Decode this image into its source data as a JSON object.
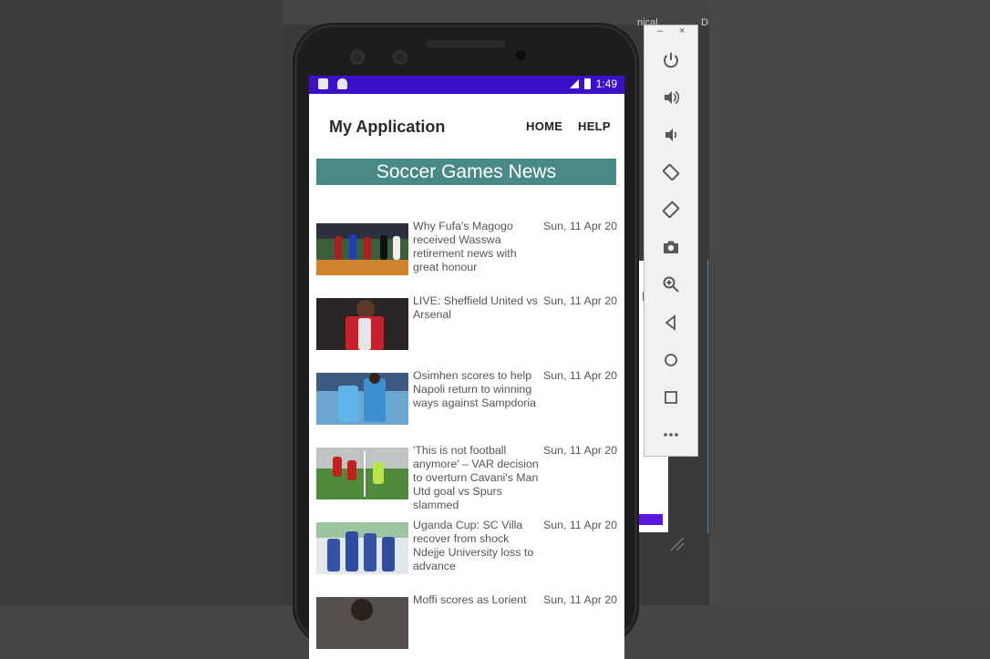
{
  "background": {
    "window_text_1": "nical",
    "window_text_2": "D"
  },
  "statusbar": {
    "time": "1:49",
    "signal": "LTE"
  },
  "appbar": {
    "title": "My Application",
    "nav": [
      "HOME",
      "HELP"
    ]
  },
  "banner": {
    "title": "Soccer Games News"
  },
  "news": [
    {
      "headline": "Why Fufa's Magogo received Wasswa retirement news with great honour",
      "date": "Sun, 11 Apr 20",
      "thumb": "players-on-pitch"
    },
    {
      "headline": "LIVE: Sheffield United vs Arsenal",
      "date": "Sun, 11 Apr 20",
      "thumb": "arsenal-player"
    },
    {
      "headline": "Osimhen scores to help Napoli return to winning ways against Sampdoria",
      "date": "Sun, 11 Apr 20",
      "thumb": "napoli-celebration"
    },
    {
      "headline": "'This is not football anymore' – VAR decision to overturn Cavani's Man Utd goal vs Spurs slammed",
      "date": "Sun, 11 Apr 20",
      "thumb": "goalmouth-action"
    },
    {
      "headline": "Uganda Cup: SC Villa recover from shock Ndejje University loss to advance",
      "date": "Sun, 11 Apr 20",
      "thumb": "team-celebration"
    },
    {
      "headline": "Moffi scores as Lorient",
      "date": "Sun, 11 Apr 20",
      "thumb": "player-portrait"
    }
  ],
  "toolbar": {
    "minimize": "–",
    "close": "×",
    "buttons": [
      {
        "icon": "power-icon"
      },
      {
        "icon": "volume-up-icon"
      },
      {
        "icon": "volume-down-icon"
      },
      {
        "icon": "rotate-left-icon"
      },
      {
        "icon": "rotate-right-icon"
      },
      {
        "icon": "camera-icon"
      },
      {
        "icon": "zoom-icon"
      },
      {
        "icon": "back-icon"
      },
      {
        "icon": "home-icon"
      },
      {
        "icon": "overview-icon"
      },
      {
        "icon": "more-icon"
      }
    ]
  },
  "colors": {
    "statusbar": "#3a10c9",
    "banner": "#4a8a86",
    "text": "#555555"
  }
}
